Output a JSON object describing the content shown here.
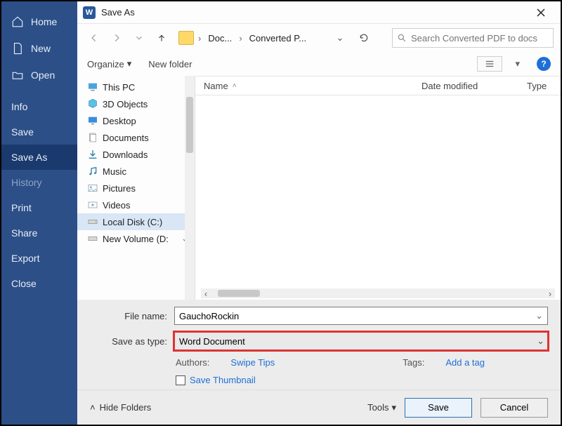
{
  "backstage": {
    "items": [
      {
        "label": "Home",
        "icon": "home"
      },
      {
        "label": "New",
        "icon": "file"
      },
      {
        "label": "Open",
        "icon": "folder-open"
      },
      {
        "label": "Info"
      },
      {
        "label": "Save"
      },
      {
        "label": "Save As",
        "selected": true
      },
      {
        "label": "History",
        "dim": true
      },
      {
        "label": "Print"
      },
      {
        "label": "Share"
      },
      {
        "label": "Export"
      },
      {
        "label": "Close"
      }
    ]
  },
  "dialog": {
    "title": "Save As",
    "breadcrumb": {
      "segments": [
        "Doc...",
        "Converted P..."
      ]
    },
    "search_placeholder": "Search Converted PDF to docs",
    "toolbar": {
      "organize": "Organize",
      "new_folder": "New folder"
    },
    "columns": {
      "name": "Name",
      "date": "Date modified",
      "type": "Type"
    },
    "tree": [
      {
        "label": "This PC",
        "icon": "pc"
      },
      {
        "label": "3D Objects",
        "icon": "3d"
      },
      {
        "label": "Desktop",
        "icon": "desktop"
      },
      {
        "label": "Documents",
        "icon": "docs"
      },
      {
        "label": "Downloads",
        "icon": "down"
      },
      {
        "label": "Music",
        "icon": "music"
      },
      {
        "label": "Pictures",
        "icon": "pic"
      },
      {
        "label": "Videos",
        "icon": "vid"
      },
      {
        "label": "Local Disk (C:)",
        "icon": "disk",
        "selected": true
      },
      {
        "label": "New Volume (D:",
        "icon": "disk"
      }
    ],
    "form": {
      "file_name_label": "File name:",
      "file_name_value": "GauchoRockin",
      "save_type_label": "Save as type:",
      "save_type_value": "Word Document",
      "authors_label": "Authors:",
      "authors_value": "Swipe Tips",
      "tags_label": "Tags:",
      "tags_value": "Add a tag",
      "save_thumbnail": "Save Thumbnail"
    },
    "footer": {
      "hide_folders": "Hide Folders",
      "tools": "Tools",
      "save": "Save",
      "cancel": "Cancel"
    }
  }
}
